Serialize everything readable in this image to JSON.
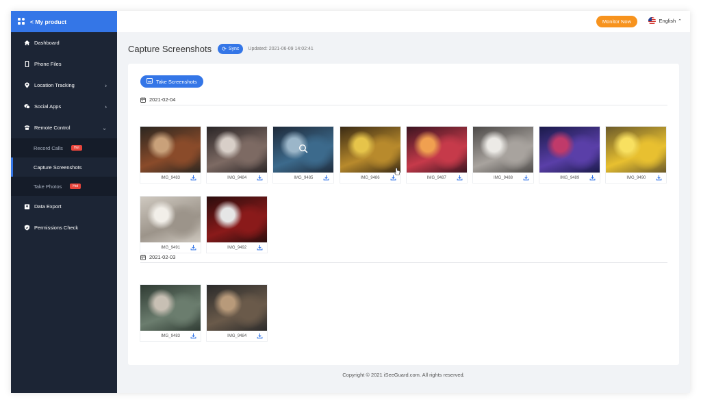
{
  "sidebar": {
    "header_label": "< My product",
    "items": [
      {
        "label": "Dashboard",
        "icon": "home-icon"
      },
      {
        "label": "Phone Files",
        "icon": "phone-icon"
      },
      {
        "label": "Location Tracking",
        "icon": "location-pin-icon",
        "expand": "chevron-right"
      },
      {
        "label": "Social Apps",
        "icon": "chat-bubble-icon",
        "expand": "chevron-right"
      },
      {
        "label": "Remote Control",
        "icon": "telephone-icon",
        "expand": "chevron-down"
      }
    ],
    "sub_items": [
      {
        "label": "Record Calls",
        "badge": "Hot"
      },
      {
        "label": "Capture Screenshots",
        "active": true
      },
      {
        "label": "Take Photos",
        "badge": "Hot"
      }
    ],
    "bottom_items": [
      {
        "label": "Data Export",
        "icon": "export-icon"
      },
      {
        "label": "Permissions Check",
        "icon": "shield-icon"
      }
    ]
  },
  "topbar": {
    "monitor_label": "Monitor Now",
    "language": "English"
  },
  "page": {
    "title": "Capture Screenshots",
    "sync_label": "Sync",
    "updated": "Updated: 2021-06-09 14:02:41",
    "take_label": "Take Screenshots"
  },
  "groups": [
    {
      "date": "2021-02-04",
      "photos": [
        "IMG_9483",
        "IMG_9484",
        "IMG_9485",
        "IMG_9486",
        "IMG_9487",
        "IMG_9488",
        "IMG_9489",
        "IMG_9490",
        "IMG_9491",
        "IMG_9492"
      ]
    },
    {
      "date": "2021-02-03",
      "photos": [
        "IMG_9483",
        "IMG_9484"
      ]
    }
  ],
  "footer": {
    "copyright": "Copyright © 2021 iSeeGuard.com. All rights reserved."
  },
  "colors": {
    "accent": "#3476e7",
    "sidebar_bg": "#1c2535",
    "monitor": "#f7931e",
    "hot_badge": "#e8453c"
  }
}
